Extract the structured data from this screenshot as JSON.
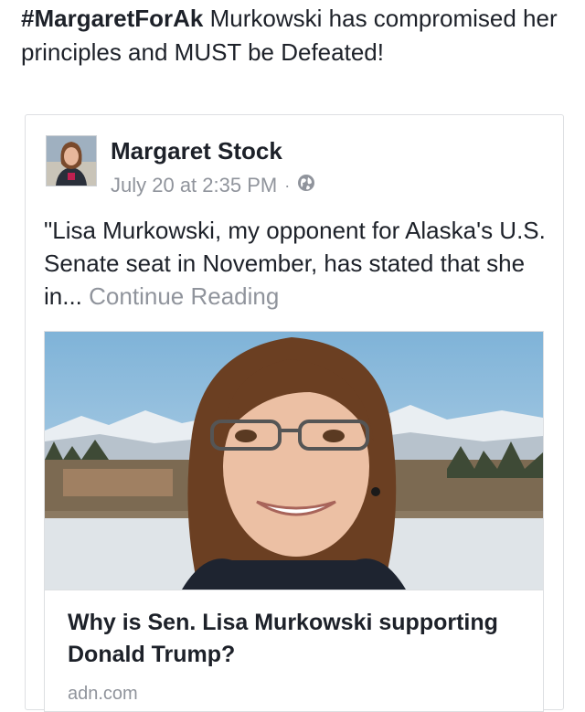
{
  "post": {
    "hashtag": "#MargaretForAk",
    "text": " Murkowski has compromised her principles and MUST be Defeated!"
  },
  "shared_post": {
    "author": "Margaret Stock",
    "timestamp": "July 20 at 2:35 PM",
    "separator": "·",
    "privacy_icon": "globe-icon",
    "quote": "\"Lisa Murkowski, my opponent for Alaska's U.S. Senate seat in November, has stated that she in...",
    "continue_label": "Continue Reading"
  },
  "link_preview": {
    "title": "Why is Sen. Lisa Murkowski supporting Donald Trump?",
    "domain": "adn.com"
  },
  "colors": {
    "text": "#1d2129",
    "secondary": "#90949c",
    "border": "#dddfe2"
  }
}
